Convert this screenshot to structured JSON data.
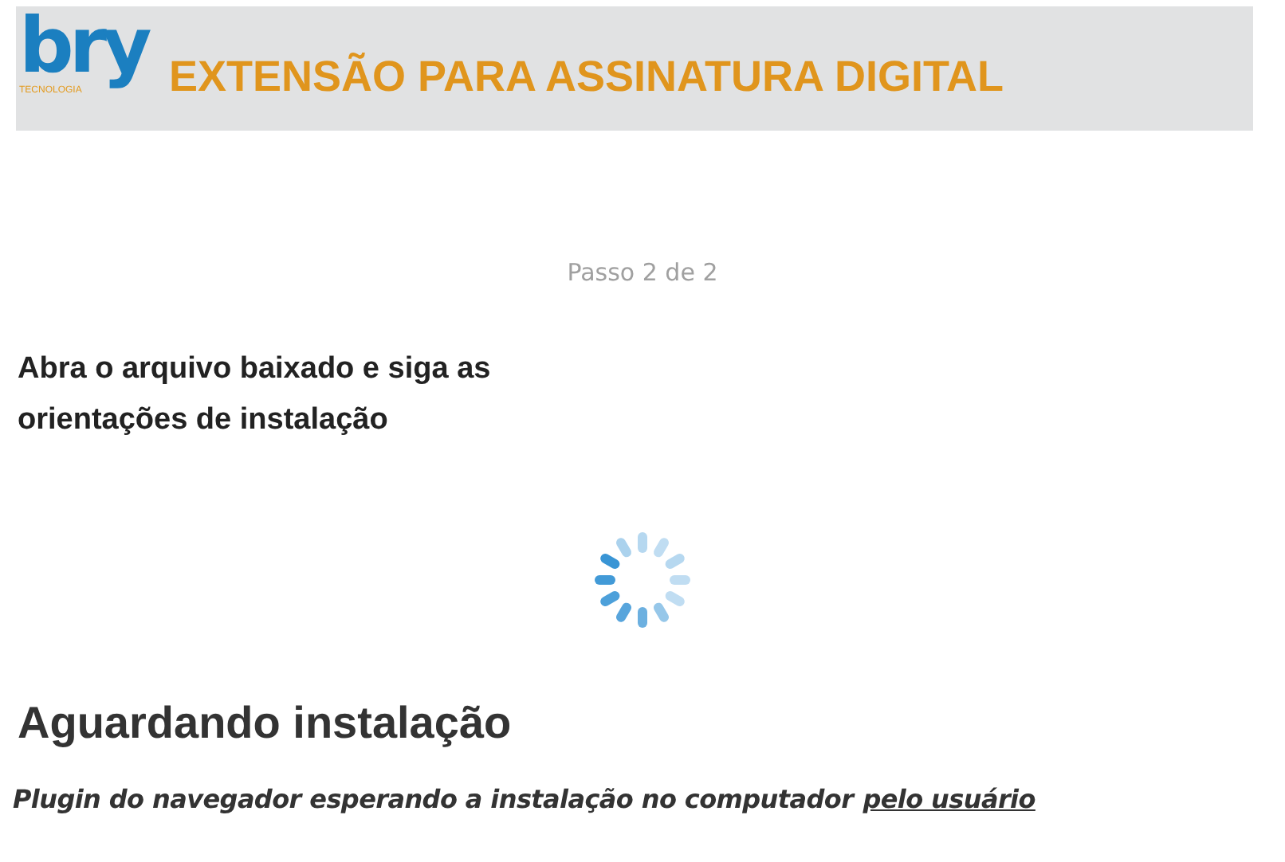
{
  "header": {
    "logo": {
      "wordmark": "bry",
      "tagline": "TECNOLOGIA"
    },
    "title": "EXTENSÃO PARA ASSINATURA DIGITAL"
  },
  "step": "Passo 2 de 2",
  "instruction": "Abra o arquivo baixado e siga as orientações de instalação",
  "status": {
    "title": "Aguardando instalação",
    "message": "Plugin do navegador esperando a instalação no computador",
    "message_emphasis": "pelo usuário"
  }
}
